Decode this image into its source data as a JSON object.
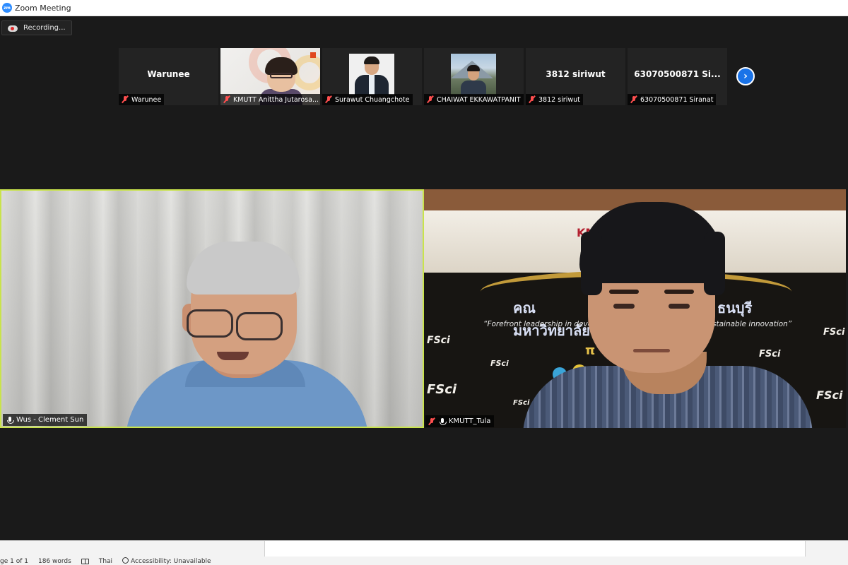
{
  "window": {
    "app_icon": "zoom-logo",
    "logo_text": "zm",
    "title": "Zoom Meeting"
  },
  "recording": {
    "icon": "cloud-record-icon",
    "label": "Recording..."
  },
  "thumbnails": [
    {
      "display": "Warunee",
      "name": "Warunee",
      "muted": true,
      "type": "name-only"
    },
    {
      "display": "",
      "name": "KMUTT Anittha Jutarosa...",
      "muted": true,
      "type": "video"
    },
    {
      "display": "",
      "name": "Surawut Chuangchote",
      "muted": true,
      "type": "photo"
    },
    {
      "display": "",
      "name": "CHAIWAT EKKAWATPANIT",
      "muted": true,
      "type": "photo"
    },
    {
      "display": "3812 siriwut",
      "name": "3812 siriwut",
      "muted": true,
      "type": "name-only"
    },
    {
      "display": "63070500871 Si...",
      "name": "63070500871 Siranat",
      "muted": true,
      "type": "name-only"
    }
  ],
  "next_page_icon": "chevron-right-icon",
  "main_tiles": [
    {
      "name": "Wus - Clement Sun",
      "muted": false,
      "active_speaker": true
    },
    {
      "name": "KMUTT_Tula",
      "muted": true,
      "active_speaker": false
    }
  ],
  "backdrop": {
    "logo": "KM",
    "thai_title_left": "คณ",
    "thai_title_line": "มหาวิทยาลัย",
    "thai_title_right": "ธนบุรี",
    "slogan_left": "“Forefront leadership in developi",
    "slogan_right": "stainable innovation”",
    "fsci": "FSci",
    "pi": "π"
  },
  "statusbar": {
    "page": "ge 1 of 1",
    "words": "186 words",
    "proofing_icon": "book-check-icon",
    "language": "Thai",
    "accessibility_icon": "accessibility-icon",
    "accessibility": "Accessibility: Unavailable"
  },
  "colors": {
    "active_speaker_border": "#c9e34c",
    "muted_mic": "#ff4f4f",
    "next_button": "#1a73e8",
    "meeting_bg": "#1a1a1a"
  }
}
